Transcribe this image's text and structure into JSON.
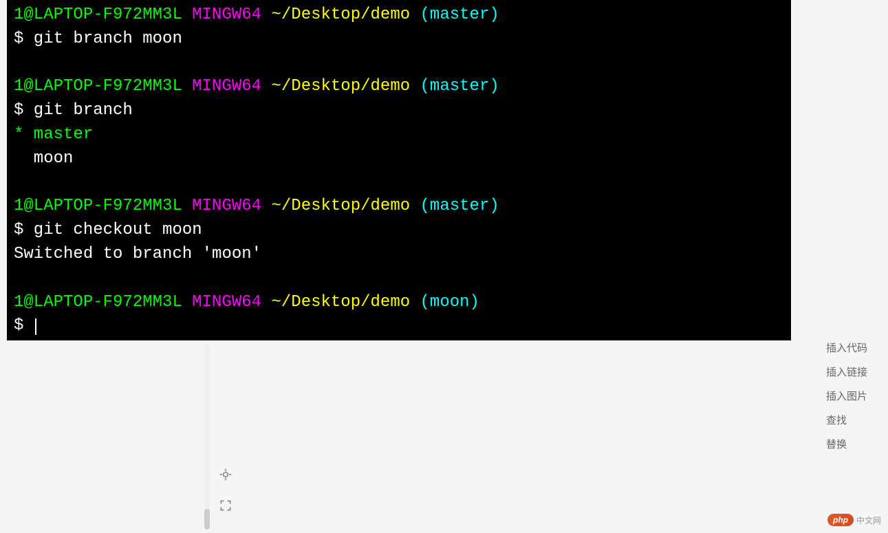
{
  "terminal": {
    "blocks": [
      {
        "prompt": {
          "userhost": "1@LAPTOP-F972MM3L",
          "env": "MINGW64",
          "path": "~/Desktop/demo",
          "branch": "(master)"
        },
        "command": "$ git branch moon",
        "output": []
      },
      {
        "prompt": {
          "userhost": "1@LAPTOP-F972MM3L",
          "env": "MINGW64",
          "path": "~/Desktop/demo",
          "branch": "(master)"
        },
        "command": "$ git branch",
        "output": [
          {
            "text": "* master",
            "class": "output-green"
          },
          {
            "text": "  moon",
            "class": "output-line"
          }
        ]
      },
      {
        "prompt": {
          "userhost": "1@LAPTOP-F972MM3L",
          "env": "MINGW64",
          "path": "~/Desktop/demo",
          "branch": "(master)"
        },
        "command": "$ git checkout moon",
        "output": [
          {
            "text": "Switched to branch 'moon'",
            "class": "output-line"
          }
        ]
      },
      {
        "prompt": {
          "userhost": "1@LAPTOP-F972MM3L",
          "env": "MINGW64",
          "path": "~/Desktop/demo",
          "branch": "(moon)"
        },
        "command": "$ ",
        "output": []
      }
    ]
  },
  "sidebar": {
    "items": [
      "插入代码",
      "插入链接",
      "插入图片",
      "查找",
      "替换"
    ]
  },
  "watermark": {
    "logo": "php",
    "text": "中文网"
  }
}
